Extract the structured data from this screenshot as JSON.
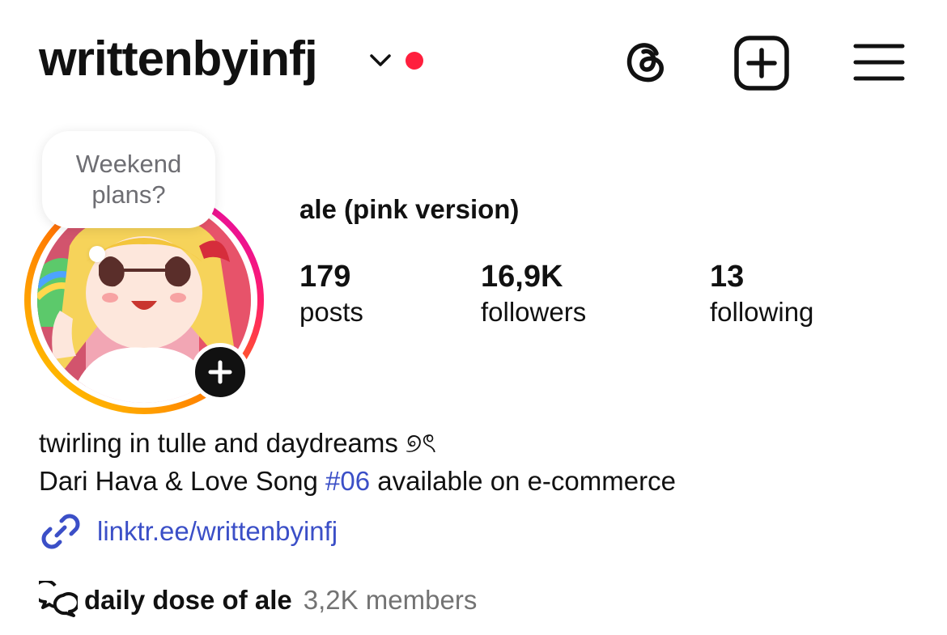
{
  "header": {
    "username": "writtenbyinfj",
    "icons": {
      "dropdown": "chevron-down-icon",
      "threads": "threads-icon",
      "create": "add-square-icon",
      "menu": "hamburger-menu-icon"
    },
    "notification_color": "#ff1f3d"
  },
  "note": {
    "text": "Weekend plans?"
  },
  "profile": {
    "display_name": "ale (pink version)",
    "stats": [
      {
        "value": "179",
        "label": "posts"
      },
      {
        "value": "16,9K",
        "label": "followers"
      },
      {
        "value": "13",
        "label": "following"
      }
    ]
  },
  "bio": {
    "line1": "twirling in tulle and daydreams ୭ৎ",
    "line2_before": "Dari Hava & Love Song ",
    "line2_hashtag": "#06",
    "line2_after": " available on e-commerce",
    "link_text": "linktr.ee/writtenbyinfj",
    "link_color": "#3b4fc7"
  },
  "channel": {
    "name": "daily dose of ale",
    "members": "3,2K members"
  }
}
